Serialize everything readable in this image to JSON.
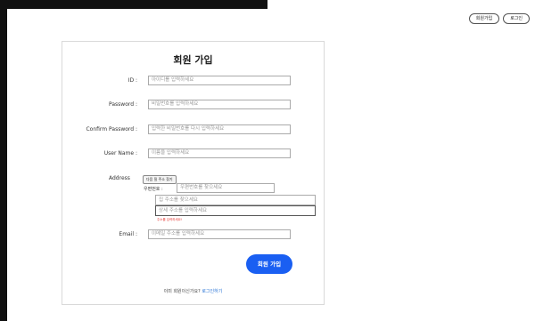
{
  "nav": {
    "signup_label": "회원가입",
    "login_label": "로그인"
  },
  "form": {
    "title": "회원 가입",
    "id": {
      "label": "ID :",
      "placeholder": "아이디를 입력하세요"
    },
    "password": {
      "label": "Password :",
      "placeholder": "비밀번호를 입력하세요"
    },
    "confirm_password": {
      "label": "Confirm Password :",
      "placeholder": "입력한 비밀번호를 다시 입력하세요"
    },
    "username": {
      "label": "User Name :",
      "placeholder": "이름을 입력하세요"
    },
    "address": {
      "label": "Address",
      "search_button": "다음 질 주소 찾기",
      "zip_label": "우편번호 :",
      "zip_placeholder": "우편번호를 찾으세요",
      "addr1_placeholder": "집 주소를 찾으세요",
      "addr2_placeholder": "상세 주소를 입력하세요",
      "warning": "주소를 입력하세요!"
    },
    "email": {
      "label": "Email :",
      "placeholder": "이메일 주소를 입력하세요"
    },
    "submit_label": "회원 가입",
    "footer": {
      "text": "이미 회원이신가요?",
      "link": "로그인하기"
    }
  }
}
